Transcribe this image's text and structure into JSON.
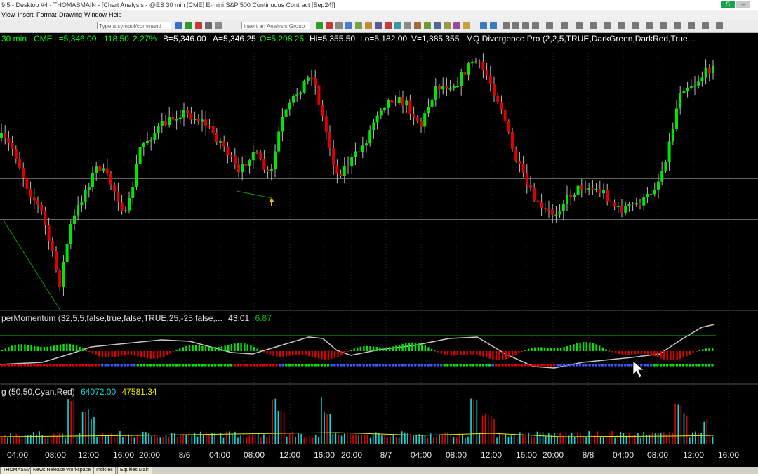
{
  "window": {
    "title": "9.5 - Desktop #4 - THOMASMAIN - [Chart Analysis - @ES 30 min [CME] E-mini S&P 500 Continuous Contract [Sep24]]",
    "btn_s": "S",
    "btn_min": "–",
    "btn_restore": "□"
  },
  "menu": {
    "view": "View",
    "insert": "Insert",
    "format": "Format",
    "drawing": "Drawing",
    "window": "Window",
    "help": "Help"
  },
  "toolbar": {
    "symbol_placeholder": "Type a symbol/command",
    "analysis_placeholder": "Insert an Analysis Group"
  },
  "quote": {
    "interval": "30 min",
    "exchange": "CME",
    "last": "L=5,346.00",
    "change": "118.50",
    "pct": "2.27%",
    "bid": "B=5,346.00",
    "ask": "A=5,346.25",
    "open": "O=5,208.25",
    "high": "Hi=5,355.50",
    "low": "Lo=5,182.00",
    "volume": "V=1,385,355",
    "study": "MQ Divergence Pro (2,2,5,TRUE,DarkGreen,DarkRed,True,..."
  },
  "momentum": {
    "label": "perMomentum (32,5,5,false,true,false,TRUE,25,-25,false,...",
    "v1": "43.01",
    "v2": "6.87"
  },
  "volume_study": {
    "label": "g (50,50,Cyan,Red)",
    "v1": "64072.00",
    "v2": "47581.34"
  },
  "colors": {
    "up": "#00e600",
    "down": "#e00000",
    "cyan": "#00e0e0",
    "quote_green": "#00ff00",
    "volume_yellow": "#e8e800",
    "divergence_line": "#00a000",
    "arrow": "#ffb000"
  },
  "xaxis": {
    "labels": [
      "04:00",
      "08:00",
      "12:00",
      "16:00",
      "20:00",
      "8/6",
      "04:00",
      "08:00",
      "12:00",
      "16:00",
      "20:00",
      "8/7",
      "04:00",
      "08:00",
      "12:00",
      "16:00",
      "20:00",
      "8/8",
      "04:00",
      "08:00",
      "12:00",
      "16:00"
    ]
  },
  "status_tabs": [
    "THOMASMAIN",
    "News Release Workspace",
    "Indicies",
    "Equities Main"
  ],
  "icons": [
    "chart-type-icon",
    "zoom-in-icon",
    "zoom-out-icon",
    "crosshair-icon",
    "drawing-line-icon",
    "cursor-icon"
  ]
}
